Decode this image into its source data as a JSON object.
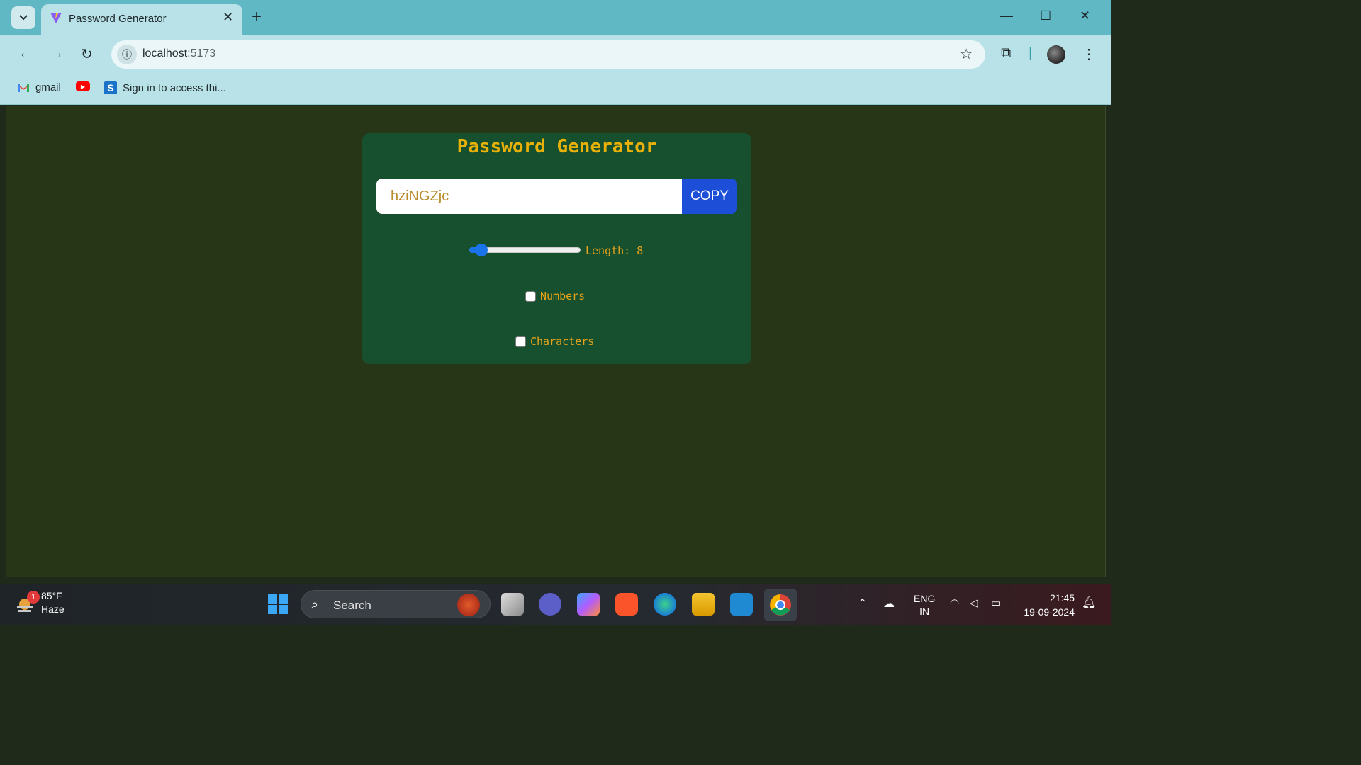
{
  "browser": {
    "tab_title": "Password Generator",
    "new_tab_label": "+",
    "url_host": "localhost",
    "url_port": ":5173",
    "bookmarks": [
      {
        "label": "gmail",
        "icon": "gmail-icon"
      },
      {
        "label": "",
        "icon": "youtube-icon"
      },
      {
        "label": "Sign in to access thi...",
        "icon": "s-app-icon"
      }
    ]
  },
  "app": {
    "title": "Password Generator",
    "password_value": "hziNGZjc",
    "copy_label": "COPY",
    "length_label": "Length: 8",
    "length_value": 8,
    "length_min": 6,
    "length_max": 100,
    "numbers_label": "Numbers",
    "numbers_checked": false,
    "characters_label": "Characters",
    "characters_checked": false
  },
  "colors": {
    "page_bg": "#283618",
    "card_bg": "#16502e",
    "title": "#e9b007",
    "label": "#e9a31a",
    "copy_button": "#1d4ed8"
  },
  "taskbar": {
    "weather_temp": "85°F",
    "weather_desc": "Haze",
    "weather_badge": "1",
    "search_label": "Search",
    "lang_line1": "ENG",
    "lang_line2": "IN",
    "time": "21:45",
    "date": "19-09-2024"
  }
}
